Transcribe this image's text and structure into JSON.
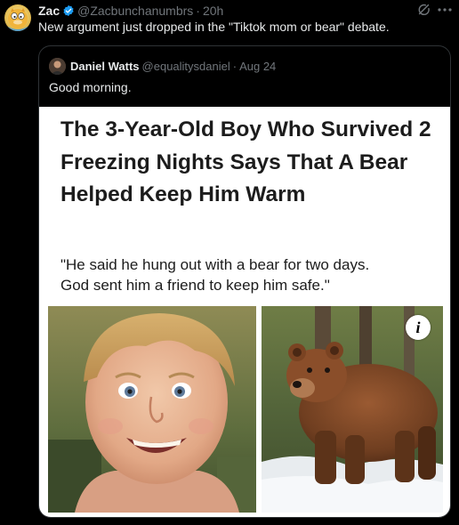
{
  "tweet": {
    "author_name": "Zac",
    "author_handle": "@Zacbunchanumbrs",
    "separator": "·",
    "time": "20h",
    "text": "New argument just dropped in the \"Tiktok mom or bear\" debate.",
    "verified": true,
    "icons": {
      "avatar": "garfield-avatar",
      "verified": "verified-badge-icon",
      "grok": "grok-icon",
      "more": "more-options-icon"
    }
  },
  "quote": {
    "author_name": "Daniel Watts",
    "author_handle": "@equalitysdaniel",
    "separator": "·",
    "date": "Aug 24",
    "text": "Good morning.",
    "article": {
      "headline": "The 3-Year-Old Boy Who Survived 2 Freezing Nights Says That A Bear Helped Keep Him Warm",
      "quote_line_1": "\"He said he hung out with a bear for two days.",
      "quote_line_2": "God sent him a friend to keep him safe.\"",
      "images": [
        "smiling-boy-photo",
        "brown-bear-photo"
      ],
      "info_label": "i"
    }
  },
  "colors": {
    "background": "#000000",
    "primary_text": "#e7e9ea",
    "secondary_text": "#71767b",
    "border": "#2f3336",
    "verified_blue": "#1d9bf0",
    "article_background": "#ffffff",
    "article_text": "#1c1c1c"
  }
}
